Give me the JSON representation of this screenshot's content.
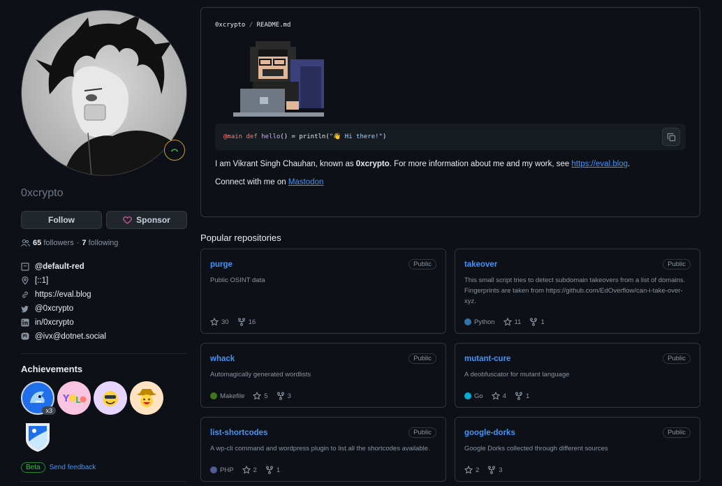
{
  "profile": {
    "username": "0xcrypto",
    "follow_label": "Follow",
    "sponsor_label": "Sponsor",
    "followers_count": "65",
    "followers_label": "followers",
    "separator": "·",
    "following_count": "7",
    "following_label": "following",
    "details": {
      "org": "@default-red",
      "location": "[::1]",
      "website": "https://eval.blog",
      "twitter": "@0xcrypto",
      "linkedin": "in/0xcrypto",
      "mastodon": "@ivx@dotnet.social"
    },
    "achievements_title": "Achievements",
    "achievement_count": "x3",
    "beta_label": "Beta",
    "feedback_label": "Send feedback"
  },
  "readme": {
    "owner": "0xcrypto",
    "slash": "/",
    "file": "README.md",
    "code_prefix": "@main",
    "code_def": "def",
    "code_fn": "hello",
    "code_mid": "() = println(",
    "code_str": "\"👋 Hi there!\"",
    "code_end": ")",
    "intro_pre": "I am Vikrant Singh Chauhan, known as ",
    "intro_handle": "0xcrypto",
    "intro_mid": ". For more information about me and my work, see ",
    "intro_link": "https://eval.blog",
    "intro_end": ".",
    "connect_pre": "Connect with me on ",
    "connect_link": "Mastodon"
  },
  "popular_title": "Popular repositories",
  "repos": [
    {
      "name": "purge",
      "visibility": "Public",
      "desc": "Public OSINT data",
      "lang": "",
      "lang_color": "",
      "stars": "30",
      "forks": "16"
    },
    {
      "name": "takeover",
      "visibility": "Public",
      "desc": "This small script tries to detect subdomain takeovers from a list of domains. Fingerprints are taken from https://github.com/EdOverflow/can-i-take-over-xyz.",
      "lang": "Python",
      "lang_color": "#3572A5",
      "stars": "11",
      "forks": "1"
    },
    {
      "name": "whack",
      "visibility": "Public",
      "desc": "Automagically generated wordlists",
      "lang": "Makefile",
      "lang_color": "#427819",
      "stars": "5",
      "forks": "3"
    },
    {
      "name": "mutant-cure",
      "visibility": "Public",
      "desc": "A deobfuscator for mutant language",
      "lang": "Go",
      "lang_color": "#00ADD8",
      "stars": "4",
      "forks": "1"
    },
    {
      "name": "list-shortcodes",
      "visibility": "Public",
      "desc": "A wp-cli command and wordpress plugin to list all the shortcodes available.",
      "lang": "PHP",
      "lang_color": "#4F5D95",
      "stars": "2",
      "forks": "1"
    },
    {
      "name": "google-dorks",
      "visibility": "Public",
      "desc": "Google Dorks collected through different sources",
      "lang": "",
      "lang_color": "",
      "stars": "2",
      "forks": "3"
    }
  ]
}
